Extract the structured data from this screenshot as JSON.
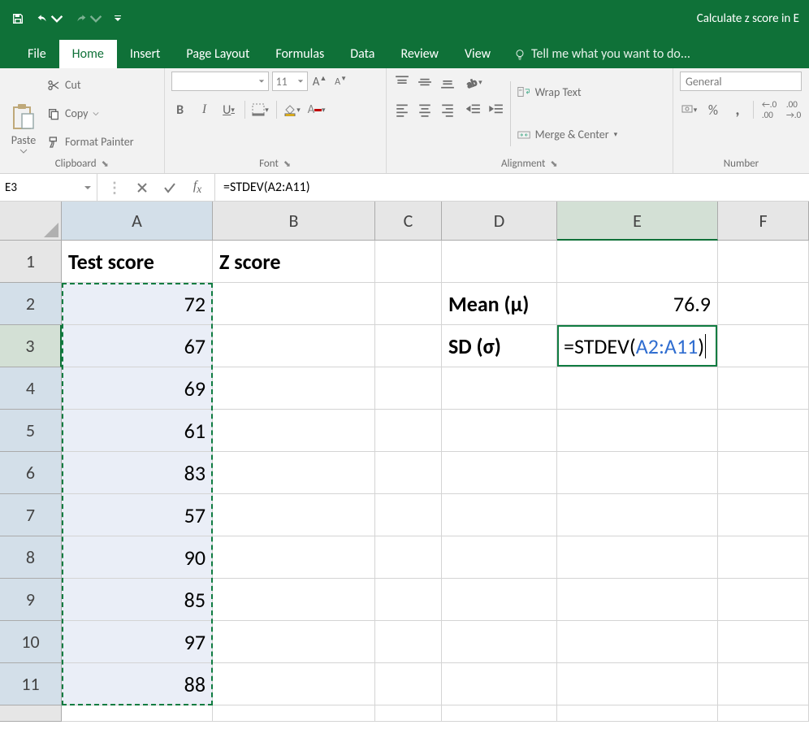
{
  "title": "Calculate z score in E",
  "tabs": {
    "file": "File",
    "home": "Home",
    "insert": "Insert",
    "page_layout": "Page Layout",
    "formulas": "Formulas",
    "data": "Data",
    "review": "Review",
    "view": "View",
    "tell_me": "Tell me what you want to do..."
  },
  "ribbon": {
    "clipboard": {
      "paste": "Paste",
      "cut": "Cut",
      "copy": "Copy",
      "format_painter": "Format Painter",
      "label": "Clipboard"
    },
    "font": {
      "size": "11",
      "label": "Font"
    },
    "alignment": {
      "wrap": "Wrap Text",
      "merge": "Merge & Center",
      "label": "Alignment"
    },
    "number": {
      "format": "General",
      "label": "Number"
    }
  },
  "formula_bar": {
    "name_box": "E3",
    "formula": "=STDEV(A2:A11)"
  },
  "columns": [
    "A",
    "B",
    "C",
    "D",
    "E",
    "F"
  ],
  "rows": [
    "1",
    "2",
    "3",
    "4",
    "5",
    "6",
    "7",
    "8",
    "9",
    "10",
    "11"
  ],
  "cells": {
    "A1": "Test score",
    "B1": "Z score",
    "A2": "72",
    "A3": "67",
    "A4": "69",
    "A5": "61",
    "A6": "83",
    "A7": "57",
    "A8": "90",
    "A9": "85",
    "A10": "97",
    "A11": "88",
    "D2": "Mean (µ)",
    "D3": "SD (σ)",
    "E2": "76.9",
    "E3_formula_prefix": "=STDEV(",
    "E3_formula_ref": "A2:A11",
    "E3_formula_suffix": ")"
  }
}
